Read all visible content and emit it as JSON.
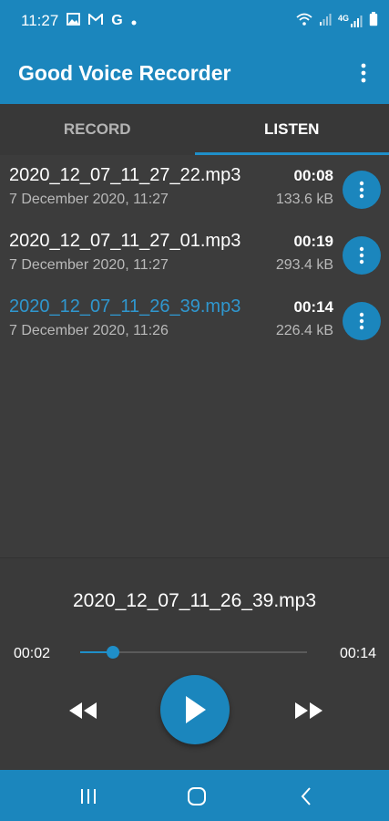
{
  "status_bar": {
    "time": "11:27",
    "left_icons": [
      "gallery-icon",
      "mail-icon",
      "google-icon",
      "dot-icon"
    ],
    "right_icons": [
      "wifi-icon",
      "signal-icon",
      "lte-signal-icon",
      "battery-icon"
    ],
    "google_glyph": "G",
    "lte_label": "4G"
  },
  "app_bar": {
    "title": "Good Voice Recorder"
  },
  "tabs": [
    {
      "label": "RECORD",
      "active": false
    },
    {
      "label": "LISTEN",
      "active": true
    }
  ],
  "recordings": [
    {
      "name": "2020_12_07_11_27_22.mp3",
      "date": "7 December 2020, 11:27",
      "duration": "00:08",
      "size": "133.6 kB",
      "playing": false
    },
    {
      "name": "2020_12_07_11_27_01.mp3",
      "date": "7 December 2020, 11:27",
      "duration": "00:19",
      "size": "293.4 kB",
      "playing": false
    },
    {
      "name": "2020_12_07_11_26_39.mp3",
      "date": "7 December 2020, 11:26",
      "duration": "00:14",
      "size": "226.4 kB",
      "playing": true
    }
  ],
  "player": {
    "title": "2020_12_07_11_26_39.mp3",
    "current_time": "00:02",
    "total_time": "00:14",
    "progress": 0.145
  },
  "colors": {
    "accent": "#1b86bd",
    "playing_text": "#2f97cf",
    "background": "#3c3c3c"
  },
  "nav_bar": {
    "buttons": [
      "recents-icon",
      "home-icon",
      "back-icon"
    ]
  }
}
